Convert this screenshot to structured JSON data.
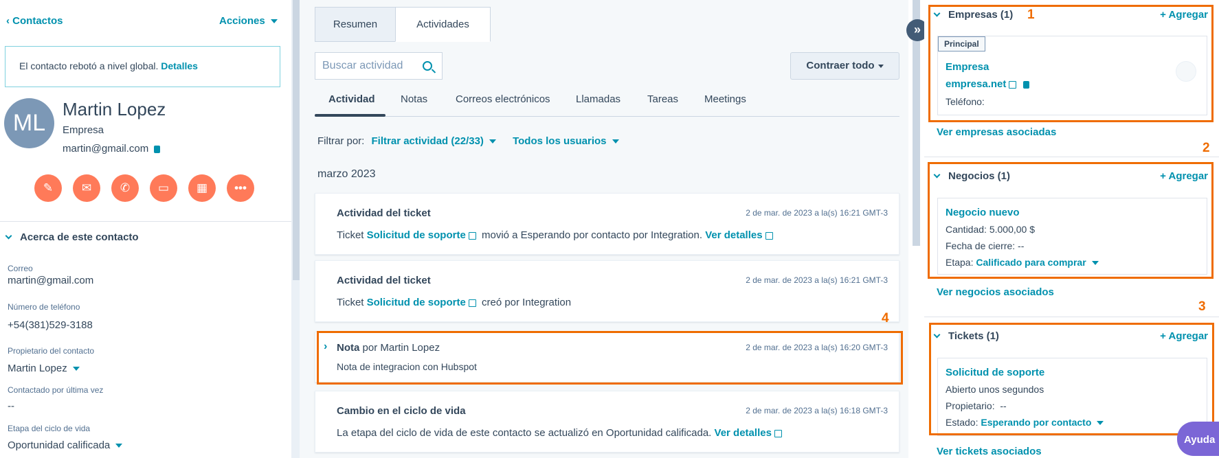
{
  "left": {
    "back_label": "Contactos",
    "actions_label": "Acciones",
    "bounce_text": "El contacto rebotó a nivel global.",
    "bounce_link": "Detalles",
    "avatar_initials": "ML",
    "name": "Martin Lopez",
    "company": "Empresa",
    "email": "martin@gmail.com",
    "action_icons": [
      "note-icon",
      "email-icon",
      "phone-icon",
      "task-icon",
      "meeting-icon",
      "more-icon"
    ],
    "about_title": "Acerca de este contacto",
    "fields": [
      {
        "label": "Correo",
        "value": "martin@gmail.com"
      },
      {
        "label": "Número de teléfono",
        "value": "+54(381)529-3188"
      },
      {
        "label": "Propietario del contacto",
        "value": "Martin Lopez"
      },
      {
        "label": "Contactado por última vez",
        "value": "--"
      },
      {
        "label": "Etapa del ciclo de vida",
        "value": "Oportunidad calificada"
      }
    ]
  },
  "middle": {
    "tabs": [
      "Resumen",
      "Actividades"
    ],
    "active_tab": "Actividades",
    "search_placeholder": "Buscar actividad",
    "collapse_label": "Contraer todo",
    "subtabs": [
      "Actividad",
      "Notas",
      "Correos electrónicos",
      "Llamadas",
      "Tareas",
      "Meetings"
    ],
    "filter_label": "Filtrar por:",
    "filter_activity": "Filtrar actividad (22/33)",
    "filter_users": "Todos los usuarios",
    "month": "marzo 2023",
    "cards": [
      {
        "title": "Actividad del ticket",
        "time": "2 de mar. de 2023 a la(s) 16:21 GMT-3",
        "prefix": "Ticket",
        "link": "Solicitud de soporte",
        "text": "movió a Esperando por contacto por Integration.",
        "details": "Ver detalles"
      },
      {
        "title": "Actividad del ticket",
        "time": "2 de mar. de 2023 a la(s) 16:21 GMT-3",
        "prefix": "Ticket",
        "link": "Solicitud de soporte",
        "text": "creó por Integration"
      },
      {
        "title": "Nota",
        "title_suffix": "por Martin Lopez",
        "time": "2 de mar. de 2023 a la(s) 16:20 GMT-3",
        "text": "Nota de integracion con Hubspot"
      },
      {
        "title": "Cambio en el ciclo de vida",
        "time": "2 de mar. de 2023 a la(s) 16:18 GMT-3",
        "text": "La etapa del ciclo de vida de este contacto se actualizó en Oportunidad calificada.",
        "details": "Ver detalles"
      }
    ]
  },
  "right": {
    "add_label": "+ Agregar",
    "companies": {
      "title": "Empresas (1)",
      "badge": "Principal",
      "name": "Empresa",
      "domain": "empresa.net",
      "phone_label": "Teléfono:",
      "view_all": "Ver empresas asociadas"
    },
    "deals": {
      "title": "Negocios (1)",
      "name": "Negocio nuevo",
      "amount": "Cantidad: 5.000,00 $",
      "close_date": "Fecha de cierre: --",
      "stage_label": "Etapa:",
      "stage_value": "Calificado para comprar",
      "view_all": "Ver negocios asociados"
    },
    "tickets": {
      "title": "Tickets (1)",
      "name": "Solicitud de soporte",
      "opened": "Abierto unos segundos",
      "owner": "Propietario:  --",
      "status_label": "Estado:",
      "status_value": "Esperando por contacto",
      "view_all": "Ver tickets asociados"
    },
    "help_label": "Ayuda"
  },
  "annotations": [
    "1",
    "2",
    "3",
    "4"
  ],
  "colors": {
    "accent": "#0091ae",
    "action_buttons": "#ff7a59",
    "highlight": "#ef6c00",
    "help": "#7b66d6"
  }
}
